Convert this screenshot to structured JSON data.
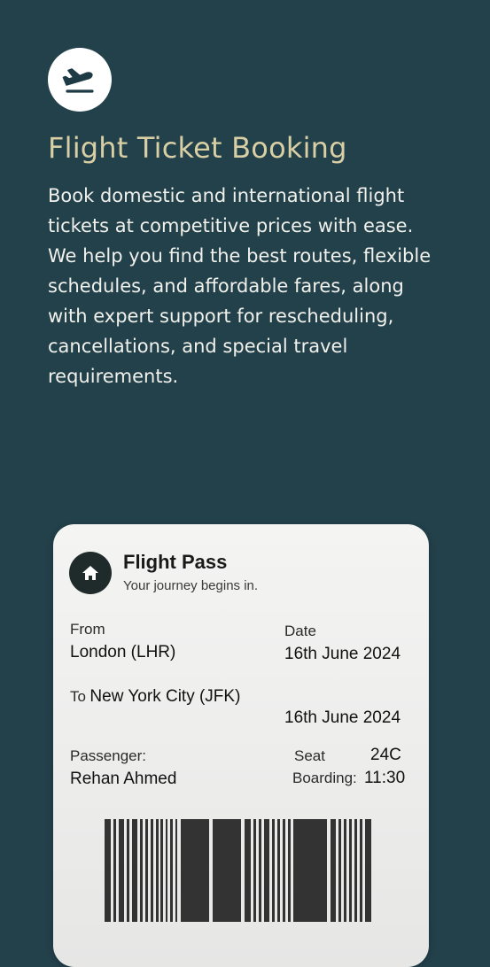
{
  "hero": {
    "title": "Flight Ticket Booking",
    "description": "Book domestic and international flight tickets at competitive prices with ease. We help you find the best routes, flexible schedules, and affordable fares, along with expert support for rescheduling, cancellations, and special travel requirements.",
    "icon": "airplane-takeoff-icon"
  },
  "pass": {
    "icon": "home-icon",
    "title": "Flight Pass",
    "subtitle": "Your journey begins in.",
    "from_label": "From",
    "from_value": "London (LHR)",
    "date_label": "Date",
    "date_value": "16th June 2024",
    "to_label": "To",
    "to_value": "New York City (JFK)",
    "to_date_value": "16th June 2024",
    "passenger_label": "Passenger:",
    "passenger_value": "Rehan Ahmed",
    "seat_label": "Seat",
    "seat_value": "24C",
    "boarding_label": "Boarding:",
    "boarding_value": "11:30"
  },
  "colors": {
    "background": "#23414b",
    "title": "#d8cfa4",
    "body_text": "#f1f1ec",
    "card": "#f0f0ef"
  }
}
